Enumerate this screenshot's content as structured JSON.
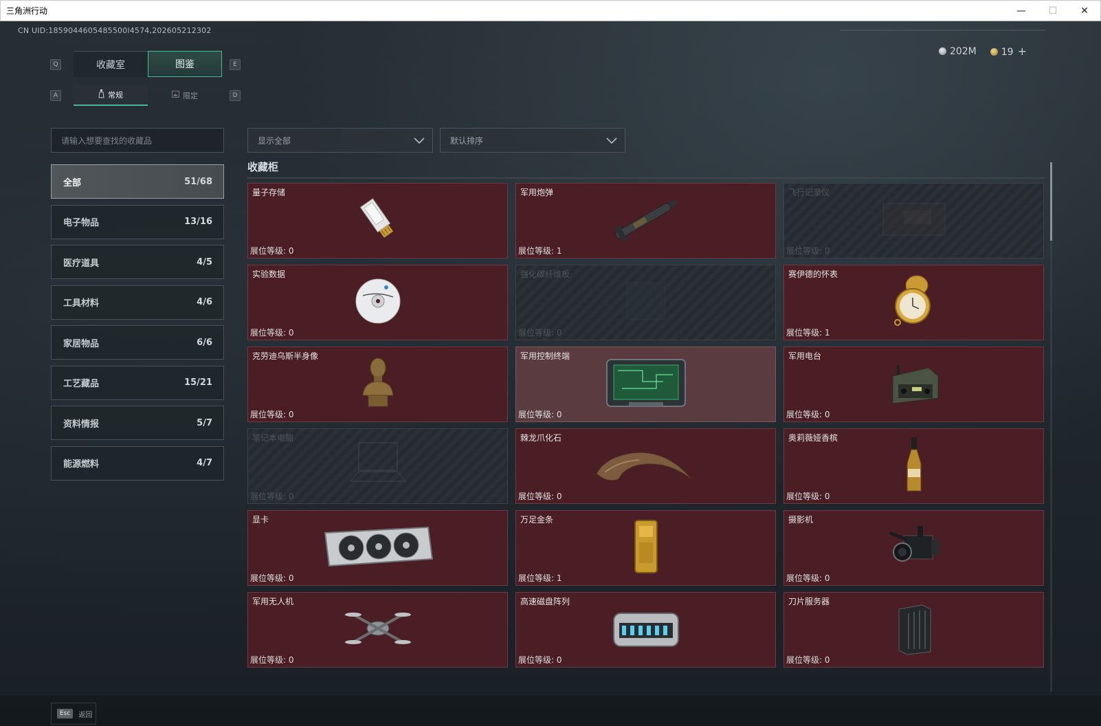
{
  "window": {
    "title": "三角洲行动",
    "minimize": "—",
    "maximize": "☐",
    "close": "✕"
  },
  "uid": "CN UID:1859044605485500l4574,202605212302",
  "currency": {
    "silver": "202M",
    "gold": "19",
    "plus": "+"
  },
  "keys": {
    "q": "Q",
    "e": "E",
    "a": "A",
    "d": "D"
  },
  "tabs": [
    {
      "label": "收藏室"
    },
    {
      "label": "图鉴"
    }
  ],
  "subtabs": [
    {
      "label": "常规"
    },
    {
      "label": "限定"
    }
  ],
  "search": {
    "placeholder": "请输入想要查找的收藏品"
  },
  "filters": {
    "show": "显示全部",
    "sort": "默认排序"
  },
  "categories": [
    {
      "label": "全部",
      "count": "51/68"
    },
    {
      "label": "电子物品",
      "count": "13/16"
    },
    {
      "label": "医疗道具",
      "count": "4/5"
    },
    {
      "label": "工具材料",
      "count": "4/6"
    },
    {
      "label": "家居物品",
      "count": "6/6"
    },
    {
      "label": "工艺藏品",
      "count": "15/21"
    },
    {
      "label": "资料情报",
      "count": "5/7"
    },
    {
      "label": "能源燃料",
      "count": "4/7"
    }
  ],
  "section": {
    "title": "收藏柜"
  },
  "level_prefix": "展位等级:",
  "items": [
    {
      "name": "量子存储",
      "level": "展位等级: 0",
      "icon": "usb-drive-icon",
      "state": "owned"
    },
    {
      "name": "军用炮弹",
      "level": "展位等级: 1",
      "icon": "missile-icon",
      "state": "owned"
    },
    {
      "name": "飞行记录仪",
      "level": "展位等级: 0",
      "icon": "flight-recorder-icon",
      "state": "locked"
    },
    {
      "name": "实验数据",
      "level": "展位等级: 0",
      "icon": "disc-icon",
      "state": "owned"
    },
    {
      "name": "强化碳纤维板",
      "level": "展位等级: 0",
      "icon": "carbon-plate-icon",
      "state": "locked"
    },
    {
      "name": "赛伊德的怀表",
      "level": "展位等级: 1",
      "icon": "pocket-watch-icon",
      "state": "owned"
    },
    {
      "name": "克劳迪乌斯半身像",
      "level": "展位等级: 0",
      "icon": "bust-icon",
      "state": "owned"
    },
    {
      "name": "军用控制终端",
      "level": "展位等级: 0",
      "icon": "control-terminal-icon",
      "state": "highlight"
    },
    {
      "name": "军用电台",
      "level": "展位等级: 0",
      "icon": "radio-icon",
      "state": "owned"
    },
    {
      "name": "笔记本电脑",
      "level": "展位等级: 0",
      "icon": "laptop-icon",
      "state": "locked"
    },
    {
      "name": "棘龙爪化石",
      "level": "展位等级: 0",
      "icon": "claw-fossil-icon",
      "state": "owned"
    },
    {
      "name": "奥莉薇娅香槟",
      "level": "展位等级: 0",
      "icon": "champagne-icon",
      "state": "owned"
    },
    {
      "name": "显卡",
      "level": "展位等级: 0",
      "icon": "graphics-card-icon",
      "state": "owned"
    },
    {
      "name": "万足金条",
      "level": "展位等级: 1",
      "icon": "gold-bar-icon",
      "state": "owned"
    },
    {
      "name": "摄影机",
      "level": "展位等级: 0",
      "icon": "camera-icon",
      "state": "owned"
    },
    {
      "name": "军用无人机",
      "level": "展位等级: 0",
      "icon": "drone-icon",
      "state": "owned"
    },
    {
      "name": "高速磁盘阵列",
      "level": "展位等级: 0",
      "icon": "disk-array-icon",
      "state": "owned"
    },
    {
      "name": "刀片服务器",
      "level": "展位等级: 0",
      "icon": "blade-server-icon",
      "state": "owned"
    }
  ],
  "footer": {
    "key": "Esc",
    "label": "返回"
  }
}
